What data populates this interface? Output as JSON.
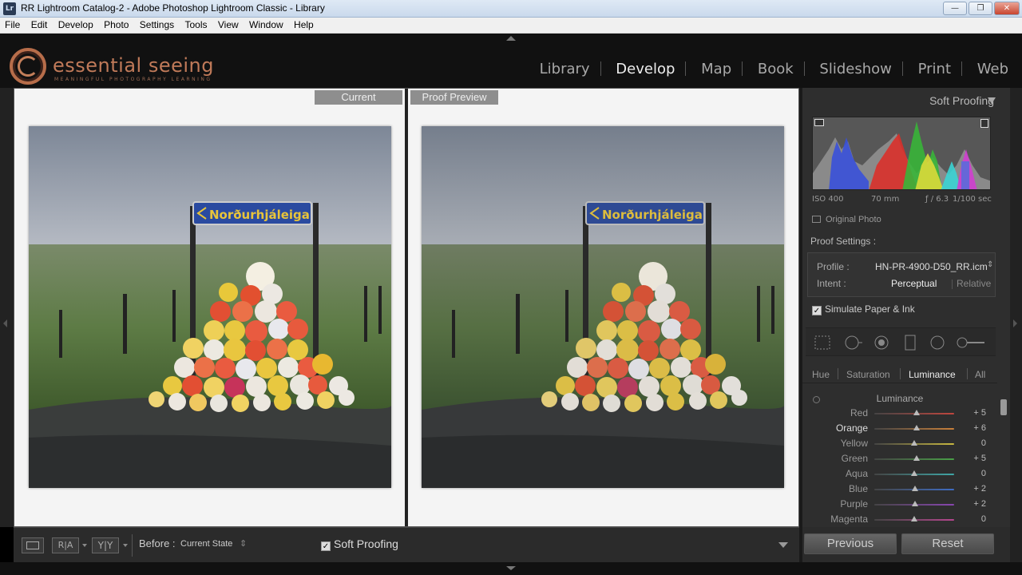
{
  "window": {
    "app_icon": "Lr",
    "title": "RR Lightroom Catalog-2 - Adobe Photoshop Lightroom Classic - Library"
  },
  "menu": [
    "File",
    "Edit",
    "Develop",
    "Photo",
    "Settings",
    "Tools",
    "View",
    "Window",
    "Help"
  ],
  "brand": {
    "name": "essential seeing",
    "tagline": "MEANINGFUL PHOTOGRAPHY LEARNING"
  },
  "modules": [
    {
      "label": "Library",
      "active": false
    },
    {
      "label": "Develop",
      "active": true
    },
    {
      "label": "Map",
      "active": false
    },
    {
      "label": "Book",
      "active": false
    },
    {
      "label": "Slideshow",
      "active": false
    },
    {
      "label": "Print",
      "active": false
    },
    {
      "label": "Web",
      "active": false
    }
  ],
  "view": {
    "left_label": "Current",
    "right_label": "Proof Preview",
    "sign_text": "Norðurhjáleiga"
  },
  "toolbar": {
    "before_label": "Before :",
    "before_value": "Current State",
    "soft_proofing": "Soft Proofing",
    "soft_proofing_checked": true
  },
  "panel": {
    "title": "Soft Proofing",
    "exif": {
      "iso": "ISO 400",
      "focal": "70 mm",
      "aperture": "ƒ / 6.3",
      "shutter": "1/100 sec"
    },
    "original_photo": "Original Photo",
    "proof_settings": "Proof Settings :",
    "profile_label": "Profile :",
    "profile_value": "HN-PR-4900-D50_RR.icm",
    "intent_label": "Intent :",
    "intent_perceptual": "Perceptual",
    "intent_relative": "Relative",
    "simulate": "Simulate Paper & Ink",
    "simulate_checked": true,
    "hsl_tabs": [
      {
        "label": "Hue",
        "active": false
      },
      {
        "label": "Saturation",
        "active": false
      },
      {
        "label": "Luminance",
        "active": true
      },
      {
        "label": "All",
        "active": false
      }
    ],
    "luminance_heading": "Luminance",
    "sliders": [
      {
        "name": "Red",
        "value": "+ 5",
        "amount": 5,
        "color": "#c0463e"
      },
      {
        "name": "Orange",
        "value": "+ 6",
        "amount": 6,
        "color": "#c9803a"
      },
      {
        "name": "Yellow",
        "value": "0",
        "amount": 0,
        "color": "#c8b840"
      },
      {
        "name": "Green",
        "value": "+ 5",
        "amount": 5,
        "color": "#49a047"
      },
      {
        "name": "Aqua",
        "value": "0",
        "amount": 0,
        "color": "#3fa6a6"
      },
      {
        "name": "Blue",
        "value": "+ 2",
        "amount": 2,
        "color": "#3e6cc3"
      },
      {
        "name": "Purple",
        "value": "+ 2",
        "amount": 2,
        "color": "#8846b0"
      },
      {
        "name": "Magenta",
        "value": "0",
        "amount": 0,
        "color": "#b5468e"
      }
    ],
    "previous": "Previous",
    "reset": "Reset"
  }
}
